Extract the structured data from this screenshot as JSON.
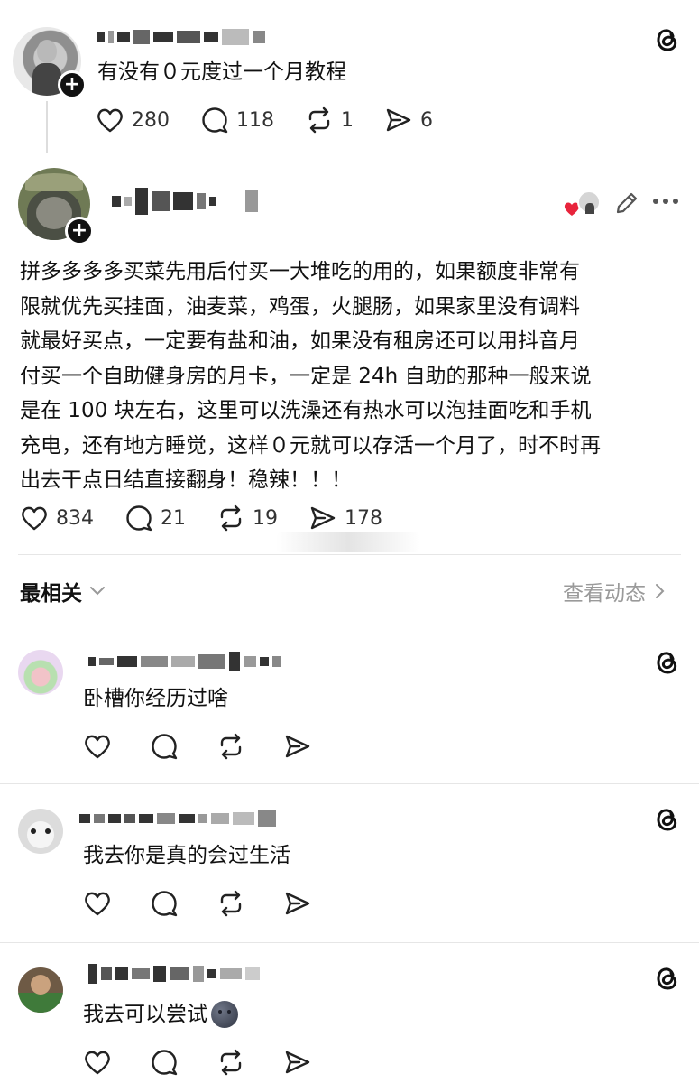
{
  "post1": {
    "text": "有没有０元度过一个月教程",
    "likes": "280",
    "comments": "118",
    "reposts": "1",
    "shares": "6"
  },
  "post2": {
    "text_lines": [
      "拼多多多多买菜先用后付买一大堆吃的用的，如果额度非常有",
      "限就优先买挂面，油麦菜，鸡蛋，火腿肠，如果家里没有调料",
      "就最好买点，一定要有盐和油，如果没有租房还可以用抖音月",
      "付买一个自助健身房的月卡，一定是 24h 自助的那种一般来说",
      "是在 100 块左右，这里可以洗澡还有热水可以泡挂面吃和手机",
      "充电，还有地方睡觉，这样０元就可以存活一个月了，时不时再",
      "出去干点日结直接翻身！稳辣！！！"
    ],
    "likes": "834",
    "comments": "21",
    "reposts": "19",
    "shares": "178"
  },
  "sort": {
    "label": "最相关",
    "activity_link": "查看动态"
  },
  "replies": [
    {
      "text": "卧槽你经历过啥"
    },
    {
      "text": "我去你是真的会过生活"
    },
    {
      "text": "我去可以尝试"
    }
  ],
  "colors": {
    "text": "#111111",
    "muted": "#9a9a9a",
    "heart": "#e8243c",
    "divider": "#e6e6e6"
  },
  "icons": [
    "threads-icon",
    "heart-icon",
    "comment-icon",
    "repost-icon",
    "share-icon",
    "edit-icon",
    "more-icon",
    "chevron-down-icon",
    "chevron-right-icon",
    "plus-icon"
  ]
}
